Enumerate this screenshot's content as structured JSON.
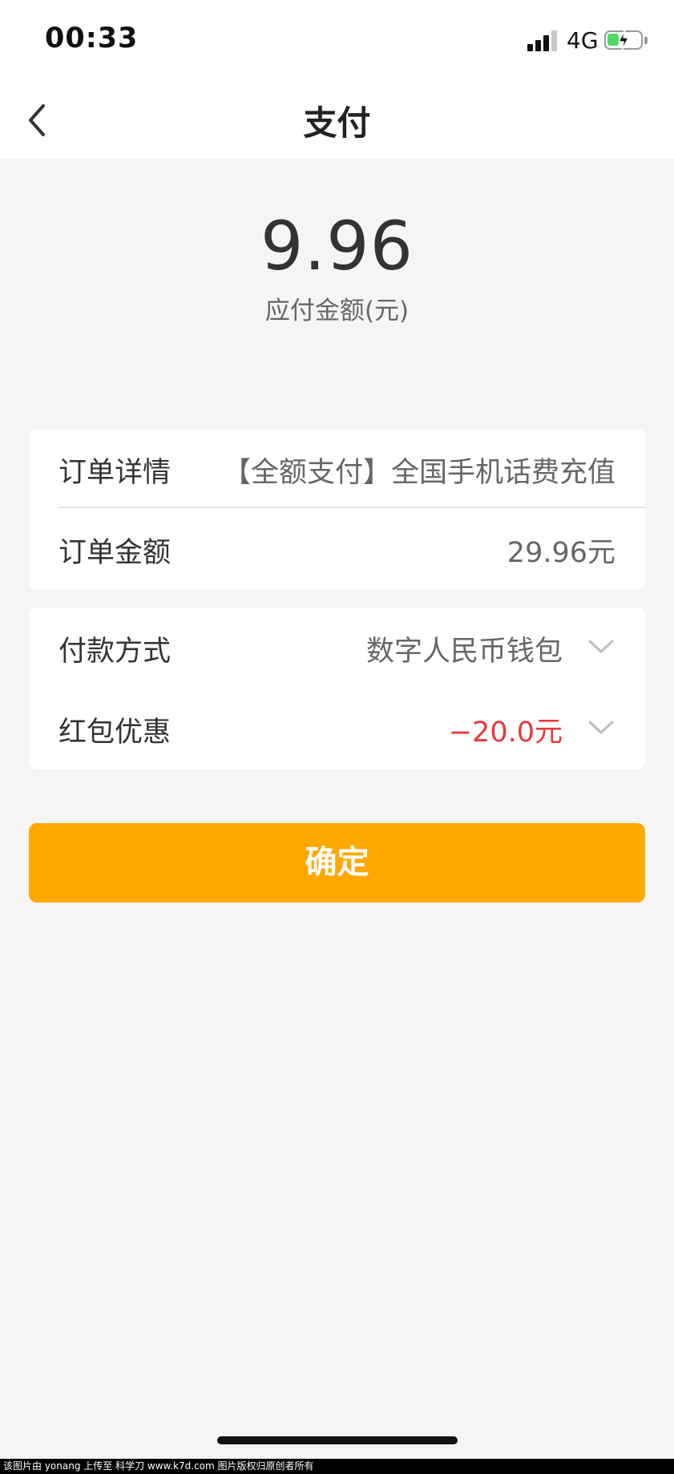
{
  "status_bar": {
    "time": "00:33",
    "network": "4G",
    "icons": [
      "cellular-signal-icon",
      "battery-charging-icon"
    ],
    "battery_level": 0.35
  },
  "nav": {
    "title": "支付",
    "back_icon": "chevron-left-icon"
  },
  "payment": {
    "amount": "9.96",
    "amount_label": "应付金额(元)"
  },
  "order": {
    "detail_label": "订单详情",
    "detail_value": "【全额支付】全国手机话费充值",
    "amount_label": "订单金额",
    "amount_value": "29.96元"
  },
  "payment_method": {
    "label": "付款方式",
    "value": "数字人民币钱包",
    "icon": "chevron-down-icon"
  },
  "discount": {
    "label": "红包优惠",
    "value": "−20.0元",
    "icon": "chevron-down-icon"
  },
  "confirm_label": "确定",
  "watermark": "该图片由 yonang 上传至 科学刀 www.k7d.com 图片版权归原创者所有",
  "colors": {
    "accent": "#ffa800",
    "discount_red": "#e8393d",
    "background": "#f5f5f5",
    "battery_green": "#4cd964"
  }
}
